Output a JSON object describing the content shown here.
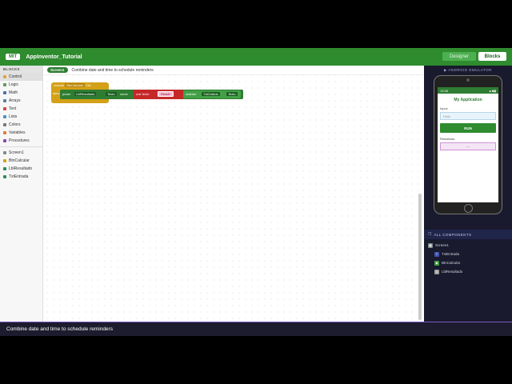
{
  "header": {
    "logo": "MIT",
    "project_title": "AppInventor_Tutorial",
    "designer_label": "Designer",
    "blocks_label": "Blocks"
  },
  "sidebar": {
    "heading": "BLOCKS",
    "categories": [
      {
        "label": "Control",
        "color": "#e6a23c"
      },
      {
        "label": "Logic",
        "color": "#5b9b5b"
      },
      {
        "label": "Math",
        "color": "#4a6fa5"
      },
      {
        "label": "Arrays",
        "color": "#5a7da8"
      },
      {
        "label": "Text",
        "color": "#d64545"
      },
      {
        "label": "Lists",
        "color": "#4a90c2"
      },
      {
        "label": "Colors",
        "color": "#777777"
      },
      {
        "label": "Variables",
        "color": "#e07b39"
      },
      {
        "label": "Procedures",
        "color": "#8e44ad"
      }
    ],
    "components": [
      {
        "label": "Screen1",
        "color": "#7f8c8d"
      },
      {
        "label": "BtnCalcular",
        "color": "#d4a017"
      },
      {
        "label": "LblResultado",
        "color": "#2e8b57"
      },
      {
        "label": "TxtEntrada",
        "color": "#2e8b57"
      }
    ]
  },
  "workspace": {
    "screen_pill": "Screen1",
    "task_description": "Combine date and time to schedule reminders",
    "event_block": {
      "when": "cuando",
      "component": "BtnCalcular",
      "event": "Clic",
      "do": "ejecutar"
    },
    "set_block": {
      "set": "poner",
      "component": "LblResultado",
      "property": "Texto",
      "to": "como"
    },
    "join_block": {
      "label": "unir texto",
      "text": "Result: "
    },
    "get_block": {
      "get": "obtener",
      "component": "TxtCelsius",
      "property": "Texto"
    }
  },
  "emulator": {
    "title": "▶ ANDROID EMULATOR",
    "status_time": "13:36",
    "status_icons": "▲◆▮",
    "app_title": "My Application",
    "input_label": "Input:",
    "input_placeholder": "Hello",
    "run_label": "RUN",
    "result_label": "Resultado:",
    "result_value": "---"
  },
  "components_panel": {
    "heading": "ALL COMPONENTS",
    "items": [
      {
        "label": "Screen1",
        "color": "#7f8c8d",
        "icon": "▣"
      },
      {
        "label": "TxtEntrada",
        "color": "#3f51b5",
        "icon": "T"
      },
      {
        "label": "BtnCalcular",
        "color": "#43a047",
        "icon": "■"
      },
      {
        "label": "LblResultado",
        "color": "#9e9e9e",
        "icon": "A"
      }
    ]
  },
  "caption": "Combine date and time to schedule reminders"
}
